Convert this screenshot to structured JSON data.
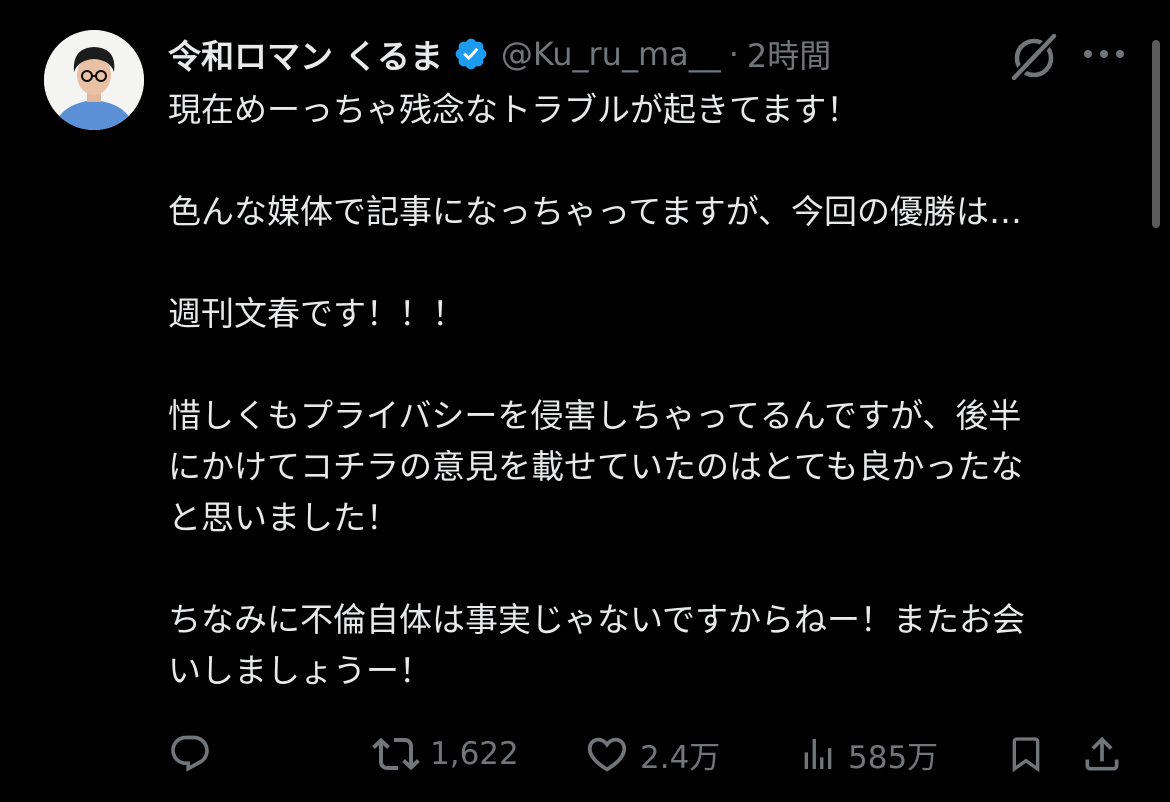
{
  "colors": {
    "background": "#000000",
    "text_primary": "#e7e9ea",
    "text_secondary": "#71767b",
    "verified_badge": "#1d9bf0"
  },
  "author": {
    "display_name": "令和ロマン くるま",
    "handle": "@Ku_ru_ma__",
    "separator": "·",
    "time": "2時間",
    "verified": true
  },
  "header_icons": {
    "grok": "grok-icon",
    "more": "more-icon"
  },
  "tweet": {
    "paragraphs": [
      "現在めーっちゃ残念なトラブルが起きてます！",
      "色んな媒体で記事になっちゃってますが、今回の優勝は…",
      "週刊文春です！！！",
      "惜しくもプライバシーを侵害しちゃってるんですが、後半\nにかけてコチラの意見を載せていたのはとても良かったな\nと思いました！",
      "ちなみに不倫自体は事実じゃないですからねー！またお会\nいしましょうー！"
    ]
  },
  "actions": {
    "reply": {
      "icon": "reply-icon",
      "count": ""
    },
    "retweet": {
      "icon": "retweet-icon",
      "count": "1,622"
    },
    "like": {
      "icon": "heart-icon",
      "count": "2.4万"
    },
    "views": {
      "icon": "views-icon",
      "count": "585万"
    },
    "bookmark": {
      "icon": "bookmark-icon"
    },
    "share": {
      "icon": "share-icon"
    }
  }
}
